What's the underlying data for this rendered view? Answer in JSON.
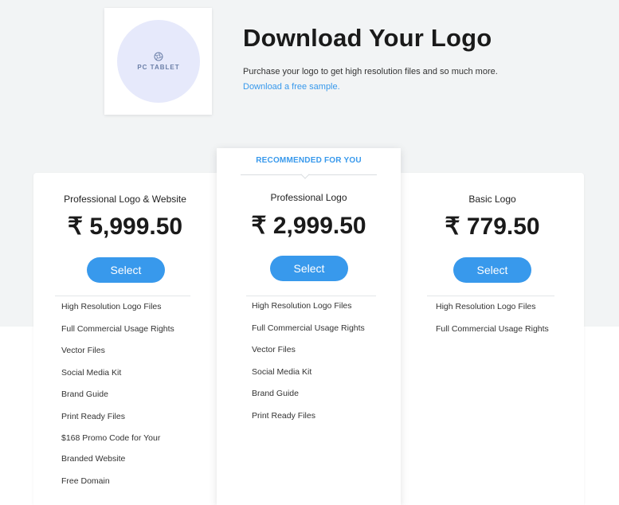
{
  "logo": {
    "text": "PC TABLET",
    "mark_icon": "camera-aperture-icon"
  },
  "hero": {
    "title": "Download Your Logo",
    "subtitle": "Purchase your logo to get high resolution files and so much more.",
    "link": "Download a free sample."
  },
  "colors": {
    "accent": "#3899ec",
    "background": "#f2f4f5",
    "card": "#ffffff"
  },
  "plans": [
    {
      "name": "Professional Logo & Website",
      "price": "₹ 5,999.50",
      "select_label": "Select",
      "features": [
        "High Resolution Logo Files",
        "Full Commercial Usage Rights",
        "Vector Files",
        "Social Media Kit",
        "Brand Guide",
        "Print Ready Files",
        "$168 Promo Code for Your",
        "Branded Website",
        "Free Domain"
      ]
    },
    {
      "badge": "RECOMMENDED FOR YOU",
      "name": "Professional Logo",
      "price": "₹ 2,999.50",
      "select_label": "Select",
      "features": [
        "High Resolution Logo Files",
        "Full Commercial Usage Rights",
        "Vector Files",
        "Social Media Kit",
        "Brand Guide",
        "Print Ready Files"
      ]
    },
    {
      "name": "Basic Logo",
      "price": "₹ 779.50",
      "select_label": "Select",
      "features": [
        "High Resolution Logo Files",
        "Full Commercial Usage Rights"
      ]
    }
  ]
}
